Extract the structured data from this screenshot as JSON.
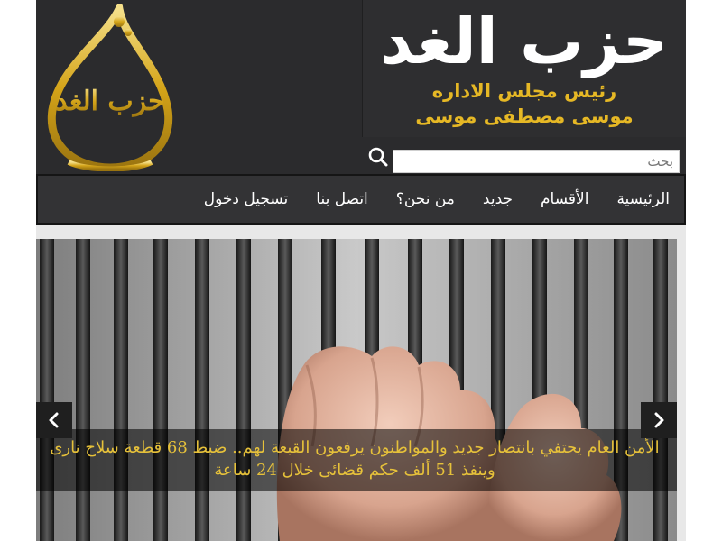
{
  "brand": {
    "logo_text": "حزب الغد",
    "banner_title": "حزب الغد",
    "banner_subtitle_1": "رئيس مجلس الاداره",
    "banner_subtitle_2": "موسى مصطفى موسى"
  },
  "search": {
    "placeholder": "بحث",
    "icon": "search-icon"
  },
  "nav": {
    "items": [
      {
        "label": "الرئيسية"
      },
      {
        "label": "الأقسام"
      },
      {
        "label": "جديد"
      },
      {
        "label": "من نحن؟"
      },
      {
        "label": "اتصل بنا"
      },
      {
        "label": "تسجيل دخول"
      }
    ]
  },
  "slider": {
    "caption": "الأمن العام يحتفي بانتصار جديد والمواطنون يرفعون القبعة لهم.. ضبط 68 قطعة سلاح نارى وينفذ 51 ألف حكم قضائى خلال 24 ساعة",
    "prev_icon": "chevron-left-icon",
    "next_icon": "chevron-right-icon"
  },
  "colors": {
    "header_bg": "#2b2b2d",
    "nav_bg": "#333335",
    "accent_gold": "#e6b825",
    "caption_text": "#e6c13a"
  }
}
